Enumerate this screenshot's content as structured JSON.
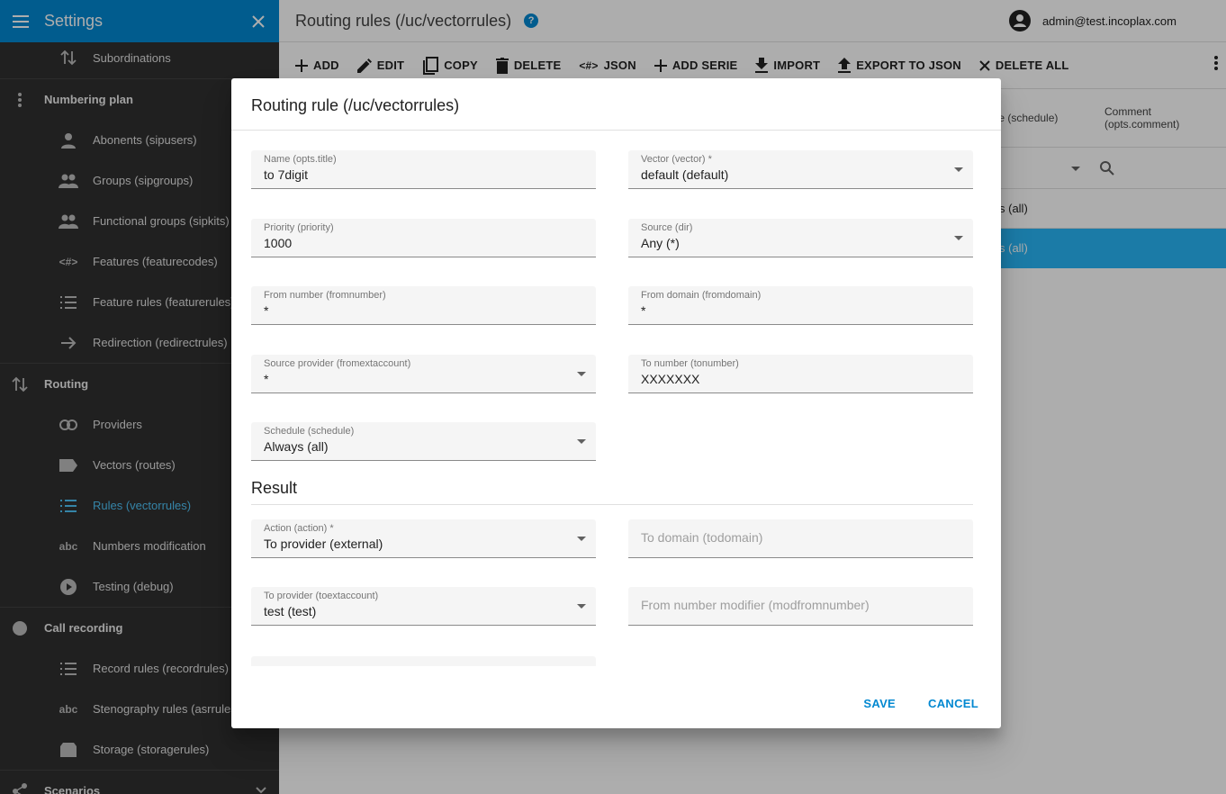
{
  "sidebar": {
    "title": "Settings",
    "items": [
      {
        "label": "Subordinations",
        "icon": "sort-arrows-icon",
        "type": "child"
      },
      {
        "label": "Numbering plan",
        "icon": "more-vert-icon",
        "type": "group"
      },
      {
        "label": "Abonents (sipusers)",
        "icon": "person-icon",
        "type": "child"
      },
      {
        "label": "Groups (sipgroups)",
        "icon": "people-icon",
        "type": "child"
      },
      {
        "label": "Functional groups (sipkits)",
        "icon": "people-icon",
        "type": "child"
      },
      {
        "label": "Features (featurecodes)",
        "icon": "code-icon",
        "type": "child"
      },
      {
        "label": "Feature rules (featurerules)",
        "icon": "list-icon",
        "type": "child"
      },
      {
        "label": "Redirection (redirectrules)",
        "icon": "arrow-right-icon",
        "type": "child"
      },
      {
        "label": "Routing",
        "icon": "sort-arrows-icon",
        "type": "group"
      },
      {
        "label": "Providers",
        "icon": "link-icon",
        "type": "child"
      },
      {
        "label": "Vectors (routes)",
        "icon": "label-icon",
        "type": "child"
      },
      {
        "label": "Rules (vectorrules)",
        "icon": "list-icon",
        "type": "child",
        "active": true
      },
      {
        "label": "Numbers modification",
        "icon": "spellcheck-icon",
        "type": "child"
      },
      {
        "label": "Testing (debug)",
        "icon": "play-circle-icon",
        "type": "child"
      },
      {
        "label": "Call recording",
        "icon": "circle-icon",
        "type": "group"
      },
      {
        "label": "Record rules (recordrules)",
        "icon": "list-icon",
        "type": "child"
      },
      {
        "label": "Stenography rules (asrrules)",
        "icon": "spellcheck-icon",
        "type": "child"
      },
      {
        "label": "Storage (storagerules)",
        "icon": "storage-icon",
        "type": "child"
      },
      {
        "label": "Scenarios",
        "icon": "share-icon",
        "type": "group"
      }
    ]
  },
  "header": {
    "page_title": "Routing rules (/uc/vectorrules)",
    "help": "?",
    "user": "admin@test.incoplax.com"
  },
  "toolbar": {
    "add": "ADD",
    "edit": "EDIT",
    "copy": "COPY",
    "delete": "DELETE",
    "json": "JSON",
    "add_serie": "ADD SERIE",
    "import": "IMPORT",
    "export": "EXPORT TO JSON",
    "delete_all": "DELETE ALL"
  },
  "table": {
    "col_schedule": "ule (schedule)",
    "col_comment_1": "Comment",
    "col_comment_2": "(opts.comment)",
    "row1_schedule": "s (all)",
    "row2_schedule": "s (all)"
  },
  "dialog": {
    "title": "Routing rule (/uc/vectorrules)",
    "fields": {
      "name": {
        "label": "Name (opts.title)",
        "value": "to 7digit"
      },
      "vector": {
        "label": "Vector (vector) *",
        "value": "default (default)"
      },
      "priority": {
        "label": "Priority (priority)",
        "value": "1000"
      },
      "source": {
        "label": "Source (dir)",
        "value": "Any (*)"
      },
      "fromnumber": {
        "label": "From number (fromnumber)",
        "value": "*"
      },
      "fromdomain": {
        "label": "From domain (fromdomain)",
        "value": "*"
      },
      "fromextaccount": {
        "label": "Source provider (fromextaccount)",
        "value": "*"
      },
      "tonumber": {
        "label": "To number (tonumber)",
        "value": "XXXXXXX"
      },
      "schedule": {
        "label": "Schedule (schedule)",
        "value": "Always (all)"
      },
      "action": {
        "label": "Action (action) *",
        "value": "To provider (external)"
      },
      "todomain": {
        "placeholder": "To domain (todomain)"
      },
      "toextaccount": {
        "label": "To provider (toextaccount)",
        "value": "test (test)"
      },
      "modfromnumber": {
        "placeholder": "From number modifier (modfromnumber)"
      }
    },
    "section_result": "Result",
    "save": "SAVE",
    "cancel": "CANCEL"
  },
  "colors": {
    "accent": "#0288d1",
    "sidebar_bg": "#303030",
    "active_item": "#4fc3f7",
    "selected_row": "#29b6f6"
  }
}
